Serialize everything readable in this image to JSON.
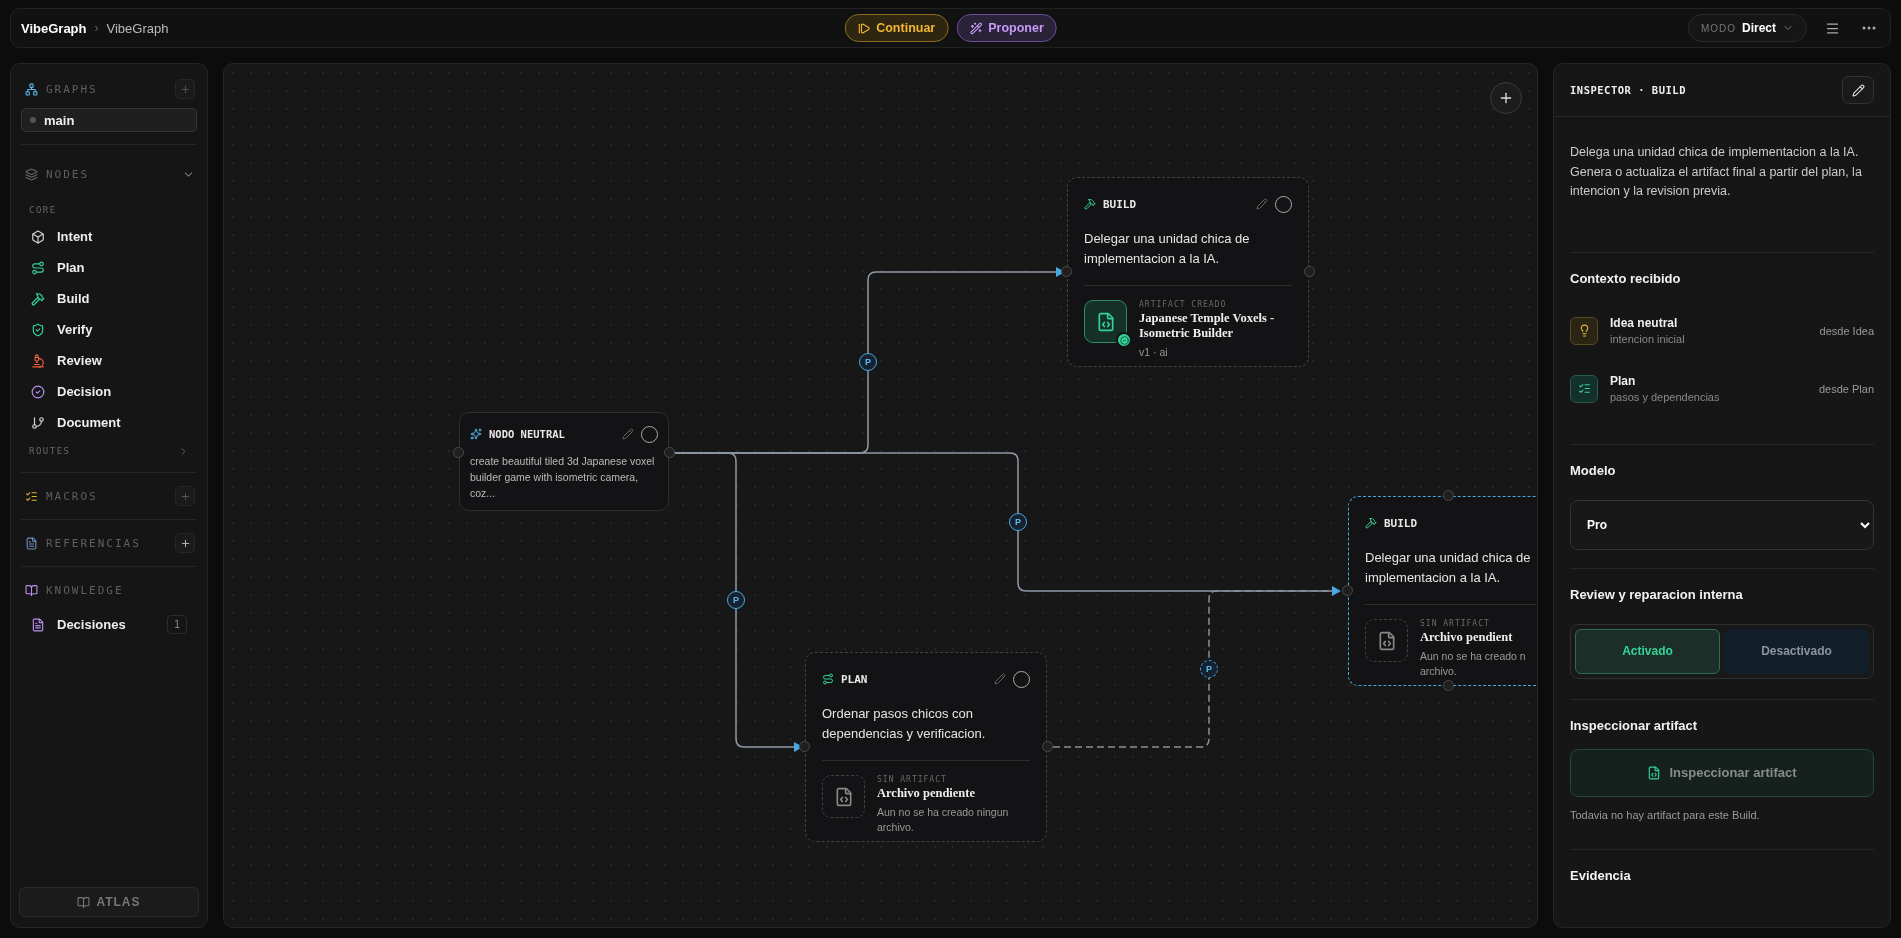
{
  "topbar": {
    "breadcrumb": [
      "VibeGraph",
      "VibeGraph"
    ],
    "separator": "›",
    "actions": [
      {
        "label": "Continuar",
        "kind": "continue"
      },
      {
        "label": "Proponer",
        "kind": "propose"
      }
    ],
    "mode": {
      "label": "MODO",
      "value": "Direct"
    }
  },
  "sidebar": {
    "graphs": {
      "title": "GRAPHS",
      "items": [
        {
          "label": "main",
          "selected": true
        }
      ]
    },
    "nodes": {
      "title": "NODES",
      "expanded": true,
      "group": "CORE",
      "items": [
        {
          "label": "Intent",
          "kind": "intent"
        },
        {
          "label": "Plan",
          "kind": "plan"
        },
        {
          "label": "Build",
          "kind": "build"
        },
        {
          "label": "Verify",
          "kind": "verify"
        },
        {
          "label": "Review",
          "kind": "review"
        },
        {
          "label": "Decision",
          "kind": "decision"
        },
        {
          "label": "Document",
          "kind": "document"
        }
      ],
      "routes": {
        "label": "ROUTES",
        "expanded": false
      }
    },
    "macros": {
      "title": "MACROS"
    },
    "references": {
      "title": "REFERENCIAS"
    },
    "knowledge": {
      "title": "KNOWLEDGE",
      "items": [
        {
          "label": "Decisiones",
          "count": "1"
        }
      ]
    },
    "footer": "ATLAS"
  },
  "canvas": {
    "nodes": [
      {
        "kind": "neutral",
        "title": "NODO NEUTRAL",
        "description": "create beautiful tiled 3d Japanese voxel builder game with isometric camera, coz...",
        "done": false,
        "selected": false
      },
      {
        "kind": "build",
        "title": "BUILD",
        "description": "Delegar una unidad chica de implementacion a la IA.",
        "done": false,
        "selected": false,
        "artifact": {
          "created": true,
          "status": "ARTIFACT CREADO",
          "name": "Japanese Temple Voxels - Isometric Builder",
          "meta": "v1 · ai"
        }
      },
      {
        "kind": "build",
        "title": "BUILD",
        "description": [
          "Delegar una unidad chica de",
          "implementacion a la IA."
        ],
        "selected": true,
        "artifact": {
          "created": false,
          "status": "SIN ARTIFACT",
          "name": "Archivo pendient",
          "meta": [
            "Aun no se ha creado n",
            "archivo."
          ]
        }
      },
      {
        "kind": "plan",
        "title": "PLAN",
        "description": "Ordenar pasos chicos con dependencias y verificacion.",
        "done": false,
        "selected": false,
        "artifact": {
          "created": false,
          "status": "SIN ARTIFACT",
          "name": "Archivo pendiente",
          "meta": "Aun no se ha creado ningun archivo."
        }
      }
    ],
    "edges": [
      {
        "label": "P",
        "dashed": false
      },
      {
        "label": "P",
        "dashed": false
      },
      {
        "label": "P",
        "dashed": false
      },
      {
        "label": "P",
        "dashed": true
      }
    ]
  },
  "inspector": {
    "title": "INSPECTOR · BUILD",
    "description": "Delega una unidad chica de implementacion a la IA. Genera o actualiza el artifact final a partir del plan, la intencion y la revision previa.",
    "context": {
      "title": "Contexto recibido",
      "items": [
        {
          "kind": "idea",
          "title": "Idea neutral",
          "subtitle": "intencion inicial",
          "source": "desde Idea"
        },
        {
          "kind": "plan",
          "title": "Plan",
          "subtitle": "pasos y dependencias",
          "source": "desde Plan"
        }
      ]
    },
    "model": {
      "title": "Modelo",
      "value": "Pro"
    },
    "review": {
      "title": "Review y reparacion interna",
      "options": [
        {
          "label": "Activado",
          "selected": true
        },
        {
          "label": "Desactivado",
          "selected": false
        }
      ]
    },
    "artifact": {
      "title": "Inspeccionar artifact",
      "button": "Inspeccionar artifact",
      "note": "Todavia no hay artifact para este Build."
    },
    "evidence": {
      "title": "Evidencia"
    }
  }
}
